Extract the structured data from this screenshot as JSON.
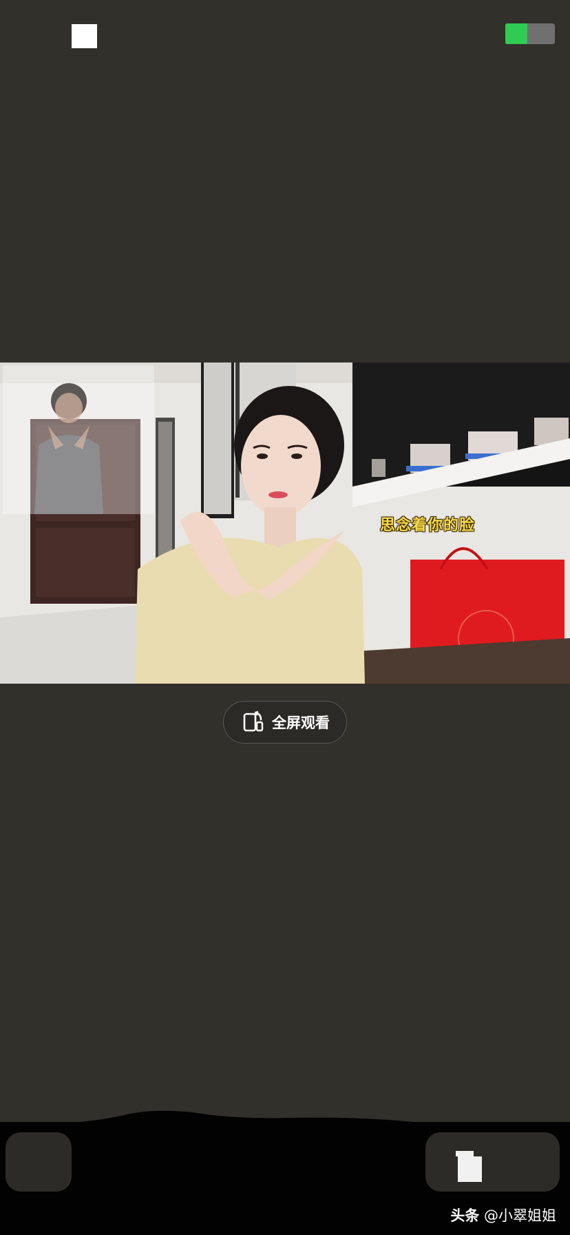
{
  "status_bar": {
    "battery_level_percent": 45,
    "battery_fill_color": "#2ecc52"
  },
  "video": {
    "caption": "思念着你的脸"
  },
  "fullscreen": {
    "label": "全屏观看",
    "icon": "rotate-screen-icon"
  },
  "watermark": {
    "brand": "头条",
    "handle": "@小翠姐姐"
  }
}
